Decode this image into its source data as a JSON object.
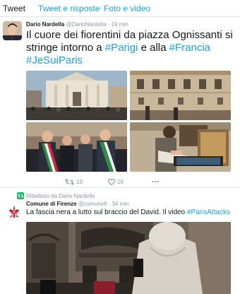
{
  "tabs": {
    "tweet": "Tweet",
    "tweet_replies": "Tweet e risposte",
    "photo_video": "Foto e video"
  },
  "tweet1": {
    "name": "Dario Nardella",
    "handle": "@DarioNardella",
    "separator": "·",
    "time": "19 min",
    "text_before": "Il cuore dei fiorentini da piazza Ognissanti si stringe intorno a ",
    "hashtag1": "#Parigi",
    "text_middle": " e alla ",
    "hashtag2": "#Francia",
    "text_break": " ",
    "hashtag3": "#JeSuiParis",
    "retweets": "19",
    "likes": "16"
  },
  "tweet2": {
    "retweeted_by": "Ritwittato da Dario Nardella",
    "name": "Comune di Firenze",
    "handle": "@comunefi",
    "separator": "·",
    "time": "34 min",
    "text": "La fascia nera a lutto sul braccio del David. Il video ",
    "hashtag": "#ParisAttacks"
  },
  "colors": {
    "accent": "#1da1f2",
    "secondary_text": "#8899a6",
    "like": "#e0245e",
    "retweet": "#17bf63"
  },
  "icons": {
    "reply": "reply-icon",
    "retweet": "retweet-icon",
    "like": "heart-icon",
    "more": "more-icon"
  }
}
